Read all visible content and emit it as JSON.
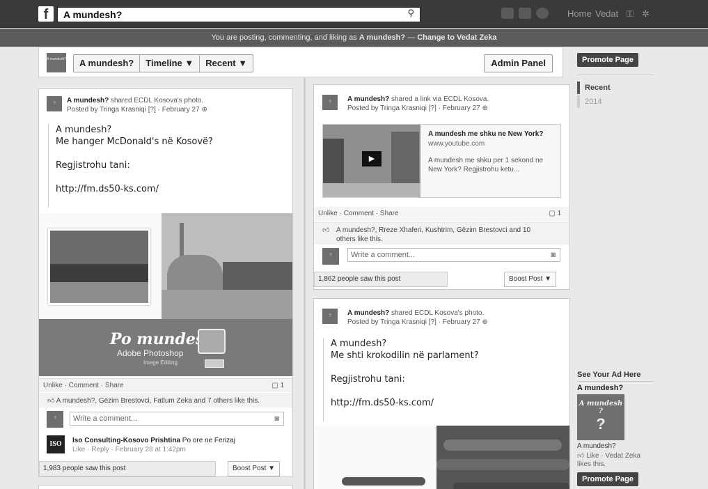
{
  "topbar": {
    "search_value": "A mundesh?",
    "nav": {
      "home": "Home",
      "user": "Vedat"
    }
  },
  "notice": {
    "prefix": "You are posting, commenting, and liking as ",
    "page": "A mundesh?",
    "dash": " — ",
    "change": "Change to Vedat Zeka"
  },
  "pagehead": {
    "thumb": "A mundesh?",
    "name": "A mundesh?",
    "timeline": "Timeline ▼",
    "recent": "Recent ▼",
    "admin": "Admin Panel"
  },
  "post1": {
    "author": "A mundesh?",
    "action": " shared ECDL Kosova's photo.",
    "posted": "Posted by Tringa Krasniqi [?] · February 27",
    "line1": "A mundesh?",
    "line2": "Me hanger McDonald's në Kosovë?",
    "line3": "Regjistrohu tani:",
    "line4": "http://fm.ds50-ks.com/",
    "banner_title": "Po mundesh",
    "banner_sub": "Adobe Photoshop",
    "banner_sub2": "Image Editing",
    "actions": "Unlike · Comment · Share",
    "comment_count": "1",
    "likes": "A mundesh?, Gëzim Brestovci, Fatlum Zeka and 7 others like this.",
    "comment_placeholder": "Write a comment...",
    "commenter": "Iso Consulting-Kosovo Prishtina",
    "comment_text": " Po ore ne Ferizaj",
    "comment_meta": "Like · Reply · February 28 at 1:42pm",
    "seen": "1,983 people saw this post",
    "boost": "Boost Post ▼"
  },
  "post2": {
    "author": "A mundesh?",
    "action": " shared a link via ECDL Kosova.",
    "posted": "Posted by Tringa Krasniqi [?] · February 27",
    "link_title": "A mundesh me shku ne New York?",
    "link_domain": "www.youtube.com",
    "link_desc": "A mundesh me shku per 1 sekond ne New York? Regjistrohu ketu...",
    "actions": "Unlike · Comment · Share",
    "comment_count": "1",
    "likes": "A mundesh?, Rreze Xhaferi, Kushtrim, Gëzim Brestovci and 10 others like this.",
    "comment_placeholder": "Write a comment...",
    "seen": "1,862 people saw this post",
    "boost": "Boost Post ▼"
  },
  "post3": {
    "author": "A mundesh?",
    "action": " shared ECDL Kosova's photo.",
    "posted": "Posted by Tringa Krasniqi [?] · February 27",
    "line1": "A mundesh?",
    "line2": "Me shti krokodilin në parlament?",
    "line3": "Regjistrohu tani:",
    "line4": "http://fm.ds50-ks.com/"
  },
  "right": {
    "promote": "Promote Page",
    "recent": "Recent",
    "year": "2014",
    "ad_header": "See Your Ad Here",
    "ad_title": "A mundesh?",
    "ad_image_text": "A mundesh ?",
    "ad_name": "A mundesh?",
    "ad_like": "Like · Vedat Zeka likes this.",
    "promote2": "Promote Page"
  }
}
